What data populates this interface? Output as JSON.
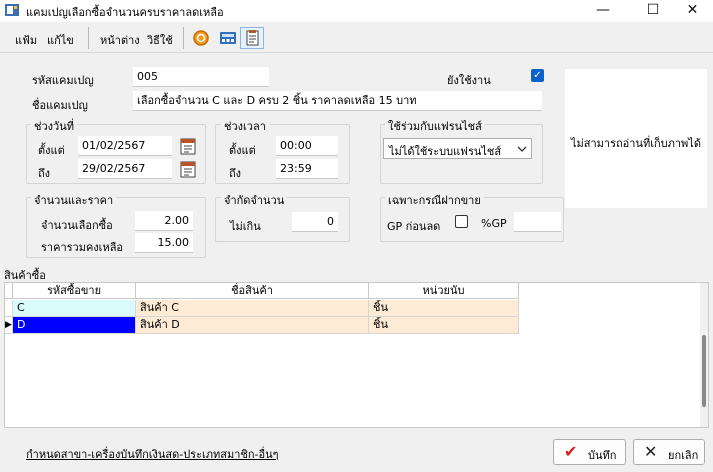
{
  "window": {
    "title": "แคมเปญเลือกซื้อจำนวนครบราคาลดเหลือ",
    "minimize_glyph": "—",
    "maximize_glyph": "☐",
    "close_glyph": "✕"
  },
  "menu": {
    "file": "แฟ้ม",
    "edit": "แก้ไข",
    "window": "หน้าต่าง",
    "help": "วิธีใช้"
  },
  "toolbar_icons": [
    "coin-icon",
    "calculator-icon",
    "copy-document-icon"
  ],
  "form": {
    "campaign_code_label": "รหัสแคมเปญ",
    "campaign_code": "005",
    "active_label": "ยังใช้งาน",
    "active_checked": true,
    "campaign_name_label": "ชื่อแคมเปญ",
    "campaign_name": "เลือกซื้อจำนวน C และ D ครบ 2 ชิ้น ราคาลดเหลือ 15 บาท"
  },
  "date_range": {
    "group_title": "ช่วงวันที่",
    "from_label": "ตั้งแต่",
    "from": "01/02/2567",
    "to_label": "ถึง",
    "to": "29/02/2567"
  },
  "time_range": {
    "group_title": "ช่วงเวลา",
    "from_label": "ตั้งแต่",
    "from": "00:00",
    "to_label": "ถึง",
    "to": "23:59"
  },
  "franchise": {
    "group_title": "ใช้ร่วมกับแฟรนไชส์",
    "selected": "ไม่ได้ใช้ระบบแฟรนไชส์"
  },
  "photo": {
    "message": "ไม่สามารถอ่านที่เก็บภาพได้"
  },
  "qty_price": {
    "group_title": "จำนวนและราคา",
    "qty_label": "จำนวนเลือกซื้อ",
    "qty": "2.00",
    "total_label": "ราคารวมคงเหลือ",
    "total": "15.00"
  },
  "limit": {
    "group_title": "จำกัดจำนวน",
    "max_label": "ไม่เกิน",
    "max": "0"
  },
  "consign": {
    "group_title": "เฉพาะกรณีฝากขาย",
    "gp_before_label": "GP ก่อนลด",
    "gp_before_checked": false,
    "gp_pct_label": "%GP",
    "gp_pct": ""
  },
  "grid": {
    "section_title": "สินค้าซื้อ",
    "columns": [
      "รหัสซื้อขาย",
      "ชื่อสินค้า",
      "หน่วยนับ"
    ],
    "rows": [
      {
        "code": "C",
        "name": "สินค้า C",
        "unit": "ชิ้น"
      },
      {
        "code": "D",
        "name": "สินค้า D",
        "unit": "ชิ้น"
      }
    ],
    "current_row_marker": "▶",
    "colors": {
      "row_bg": "#fdebd6",
      "code_cell_bg": "#d9fbfb",
      "selected_bg": "#0000ff"
    }
  },
  "footer": {
    "branch_link": "กำหนดสาขา-เครื่องบันทึกเงินสด-ประเภทสมาชิก-อื่นๆ",
    "save_label": "บันทึก",
    "save_icon": "✔",
    "cancel_label": "ยกเลิก",
    "cancel_icon": "✕"
  }
}
